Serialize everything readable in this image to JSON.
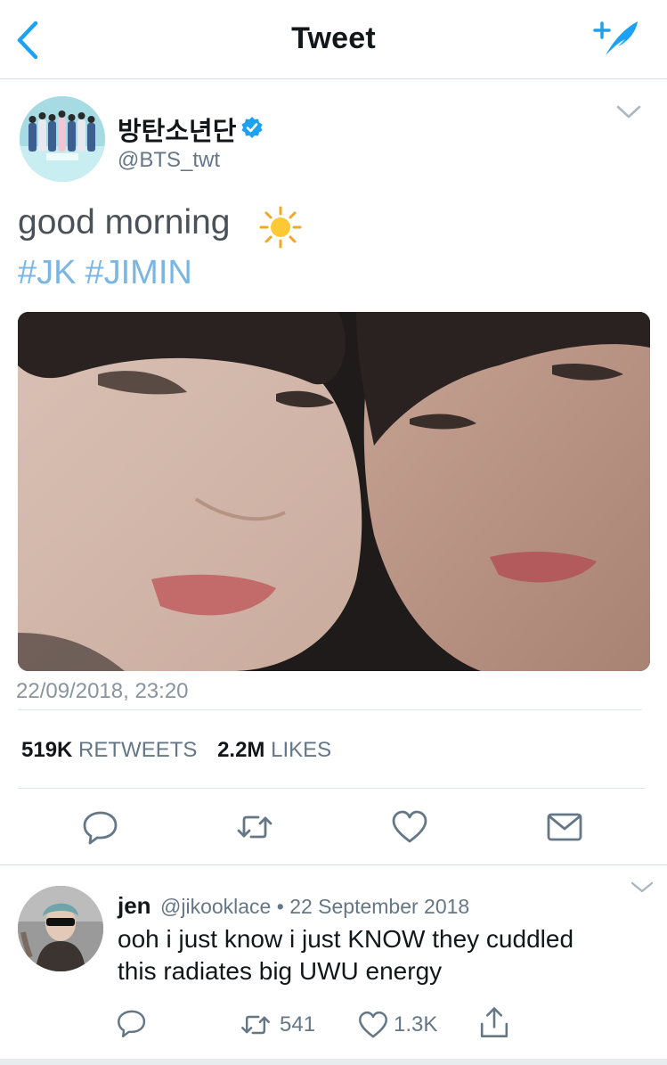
{
  "nav": {
    "title": "Tweet",
    "back_icon": "chevron-left-icon",
    "compose_icon": "compose-tweet-icon",
    "accent": "#1da1f2"
  },
  "tweet": {
    "author_name": "방탄소년단",
    "handle": "@BTS_twt",
    "verified": true,
    "text": "good morning",
    "emoji": "☀️",
    "hashtags": [
      "#JK",
      "#JIMIN"
    ],
    "hashtag_color": "#7ab6e4",
    "media": "photo-selfie",
    "timestamp": "22/09/2018, 23:20",
    "stats": {
      "retweets_count": "519K",
      "retweets_label": "RETWEETS",
      "likes_count": "2.2M",
      "likes_label": "LIKES"
    },
    "actions": [
      "reply-icon",
      "retweet-icon",
      "like-icon",
      "message-icon"
    ]
  },
  "reply": {
    "name": "jen",
    "handle": "@jikooklace",
    "separator": "•",
    "date": "22 September 2018",
    "line1": "ooh i just know i just KNOW they cuddled",
    "line2": "this radiates big UWU energy",
    "retweet_count": "541",
    "like_count": "1.3K",
    "actions": [
      "reply-icon",
      "retweet-icon",
      "like-icon",
      "share-icon"
    ]
  }
}
